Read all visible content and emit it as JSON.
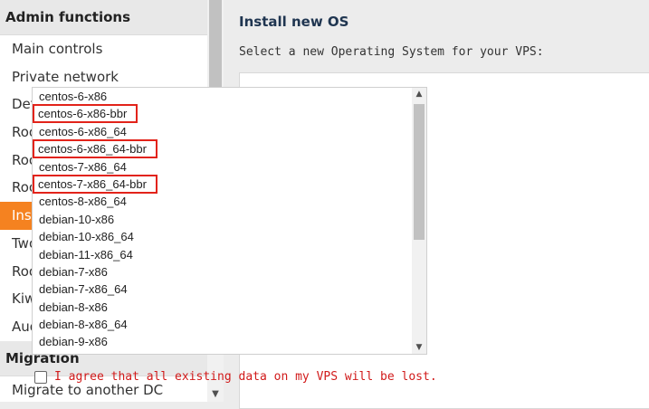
{
  "sidebar": {
    "admin_header": "Admin functions",
    "admin_items": [
      {
        "label": "Main controls"
      },
      {
        "label": "Private network"
      },
      {
        "label": "Detailed statistics"
      },
      {
        "label": "Root shell - basic"
      },
      {
        "label": "Root shell - advanced"
      },
      {
        "label": "Root shell - interactive"
      },
      {
        "label": "Install new OS",
        "active": true
      },
      {
        "label": "Two-factor authentication"
      },
      {
        "label": "Root password modification"
      },
      {
        "label": "KiwiVM password modification"
      },
      {
        "label": "Audit log"
      }
    ],
    "migration_header": "Migration",
    "migration_items": [
      {
        "label": "Migrate to another DC"
      }
    ]
  },
  "main": {
    "title": "Install new OS",
    "subtitle": "Select a new Operating System for your VPS:",
    "os_options": [
      {
        "label": "centos-6-x86"
      },
      {
        "label": "centos-6-x86-bbr",
        "highlighted": true
      },
      {
        "label": "centos-6-x86_64"
      },
      {
        "label": "centos-6-x86_64-bbr",
        "highlighted": true
      },
      {
        "label": "centos-7-x86_64"
      },
      {
        "label": "centos-7-x86_64-bbr",
        "highlighted": true
      },
      {
        "label": "centos-8-x86_64"
      },
      {
        "label": "debian-10-x86"
      },
      {
        "label": "debian-10-x86_64"
      },
      {
        "label": "debian-11-x86_64"
      },
      {
        "label": "debian-7-x86"
      },
      {
        "label": "debian-7-x86_64"
      },
      {
        "label": "debian-8-x86"
      },
      {
        "label": "debian-8-x86_64"
      },
      {
        "label": "debian-9-x86"
      }
    ],
    "agree_label": "I agree that all existing data on my VPS will be lost."
  },
  "colors": {
    "accent": "#f58220",
    "highlight_box": "#e2231a",
    "warning_text": "#d11a1a"
  }
}
